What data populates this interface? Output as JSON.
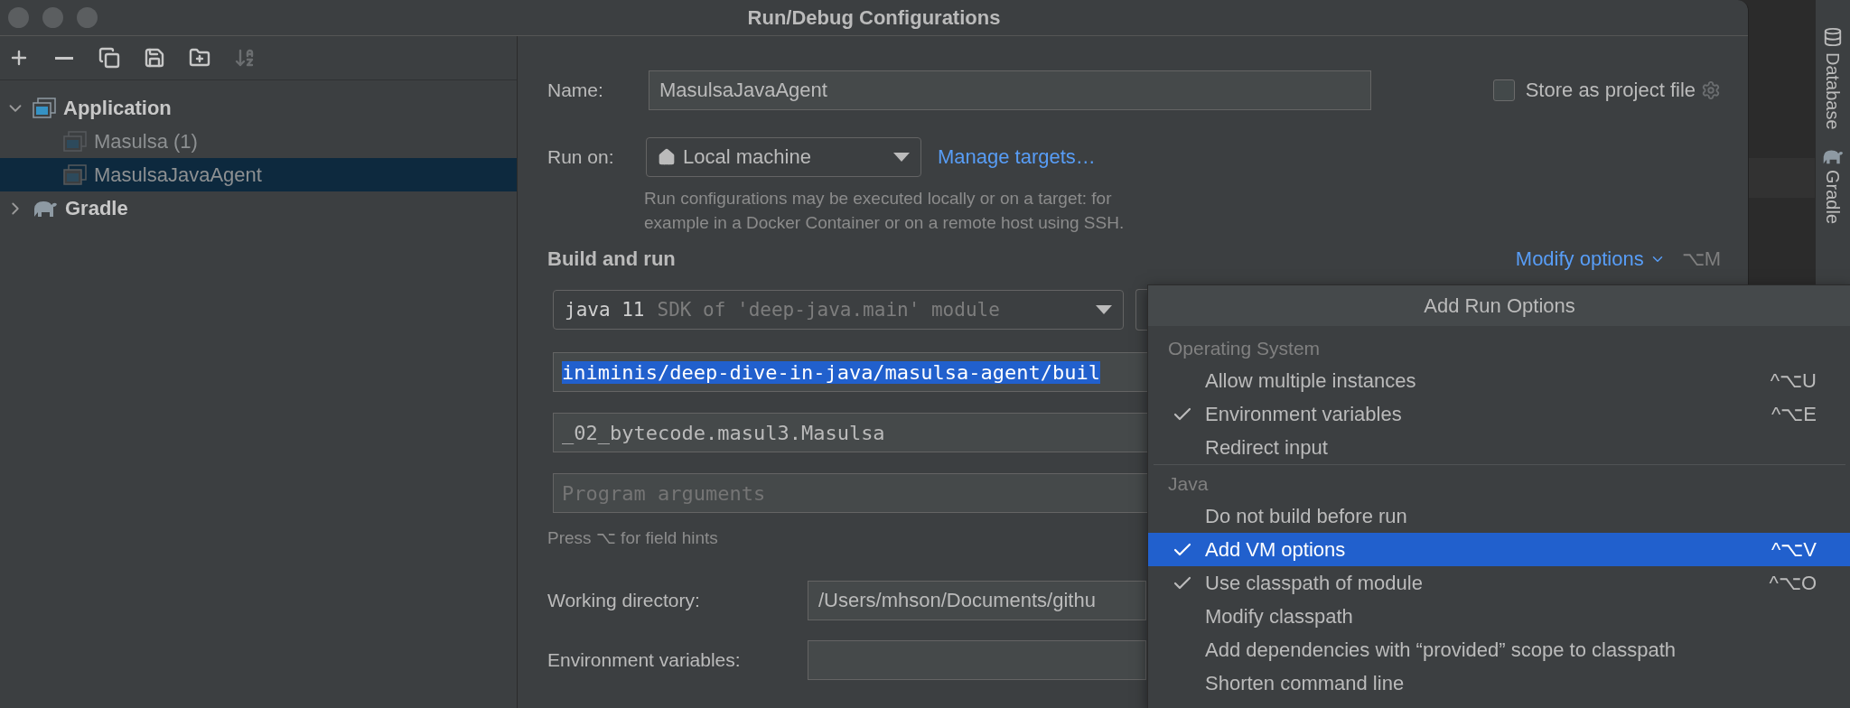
{
  "window": {
    "title": "Run/Debug Configurations"
  },
  "toolbar": [
    {
      "kind": "add",
      "disabled": false
    },
    {
      "kind": "remove",
      "disabled": false
    },
    {
      "kind": "copy",
      "disabled": false
    },
    {
      "kind": "save",
      "disabled": false
    },
    {
      "kind": "folder",
      "disabled": false
    },
    {
      "kind": "sort",
      "disabled": true
    }
  ],
  "tree": [
    {
      "label": "Application",
      "kind": "application",
      "expanded": true,
      "selected": false,
      "children": [
        {
          "label": "Masulsa (1)",
          "kind": "config",
          "selected": false
        },
        {
          "label": "MasulsaJavaAgent",
          "kind": "config",
          "selected": true
        }
      ]
    },
    {
      "label": "Gradle",
      "kind": "gradle",
      "expanded": false,
      "selected": false
    }
  ],
  "name": {
    "label": "Name:",
    "value": "MasulsaJavaAgent"
  },
  "store_as_project_file": {
    "label": "Store as project file",
    "checked": false
  },
  "run_on": {
    "label": "Run on:",
    "value": "Local machine",
    "link": "Manage targets…",
    "hint": "Run configurations may be executed locally or on a target: for example in a Docker Container or on a remote host using SSH."
  },
  "build_and_run": {
    "title": "Build and run",
    "modify_options": "Modify options",
    "modify_shortcut": "⌥M",
    "jdk": {
      "value": "java 11",
      "detail": "SDK of 'deep-java.main' module"
    },
    "vm_options": {
      "value": "iniminis/deep-dive-in-java/masulsa-agent/buil",
      "selected": true
    },
    "main_class": {
      "value": "_02_bytecode.masul3.Masulsa"
    },
    "program_arguments": {
      "placeholder": "Program arguments"
    },
    "hint": "Press ⌥ for field hints"
  },
  "working_directory": {
    "label": "Working directory:",
    "value": "/Users/mhson/Documents/githu"
  },
  "environment_variables": {
    "label": "Environment variables:"
  },
  "menu": {
    "title": "Add Run Options",
    "sections": [
      {
        "title": "Operating System",
        "items": [
          {
            "label": "Allow multiple instances",
            "checked": false,
            "selected": false,
            "shortcut": "^⌥U"
          },
          {
            "label": "Environment variables",
            "checked": true,
            "selected": false,
            "shortcut": "^⌥E"
          },
          {
            "label": "Redirect input",
            "checked": false,
            "selected": false
          }
        ]
      },
      {
        "title": "Java",
        "items": [
          {
            "label": "Do not build before run",
            "checked": false,
            "selected": false
          },
          {
            "label": "Add VM options",
            "checked": true,
            "selected": true,
            "shortcut": "^⌥V"
          },
          {
            "label": "Use classpath of module",
            "checked": true,
            "selected": false,
            "shortcut": "^⌥O"
          },
          {
            "label": "Modify classpath",
            "checked": false,
            "selected": false
          },
          {
            "label": "Add dependencies with “provided” scope to classpath",
            "checked": false,
            "selected": false
          },
          {
            "label": "Shorten command line",
            "checked": false,
            "selected": false
          }
        ]
      }
    ]
  },
  "side_tools": [
    {
      "label": "Database",
      "kind": "database"
    },
    {
      "label": "Gradle",
      "kind": "gradle"
    }
  ]
}
